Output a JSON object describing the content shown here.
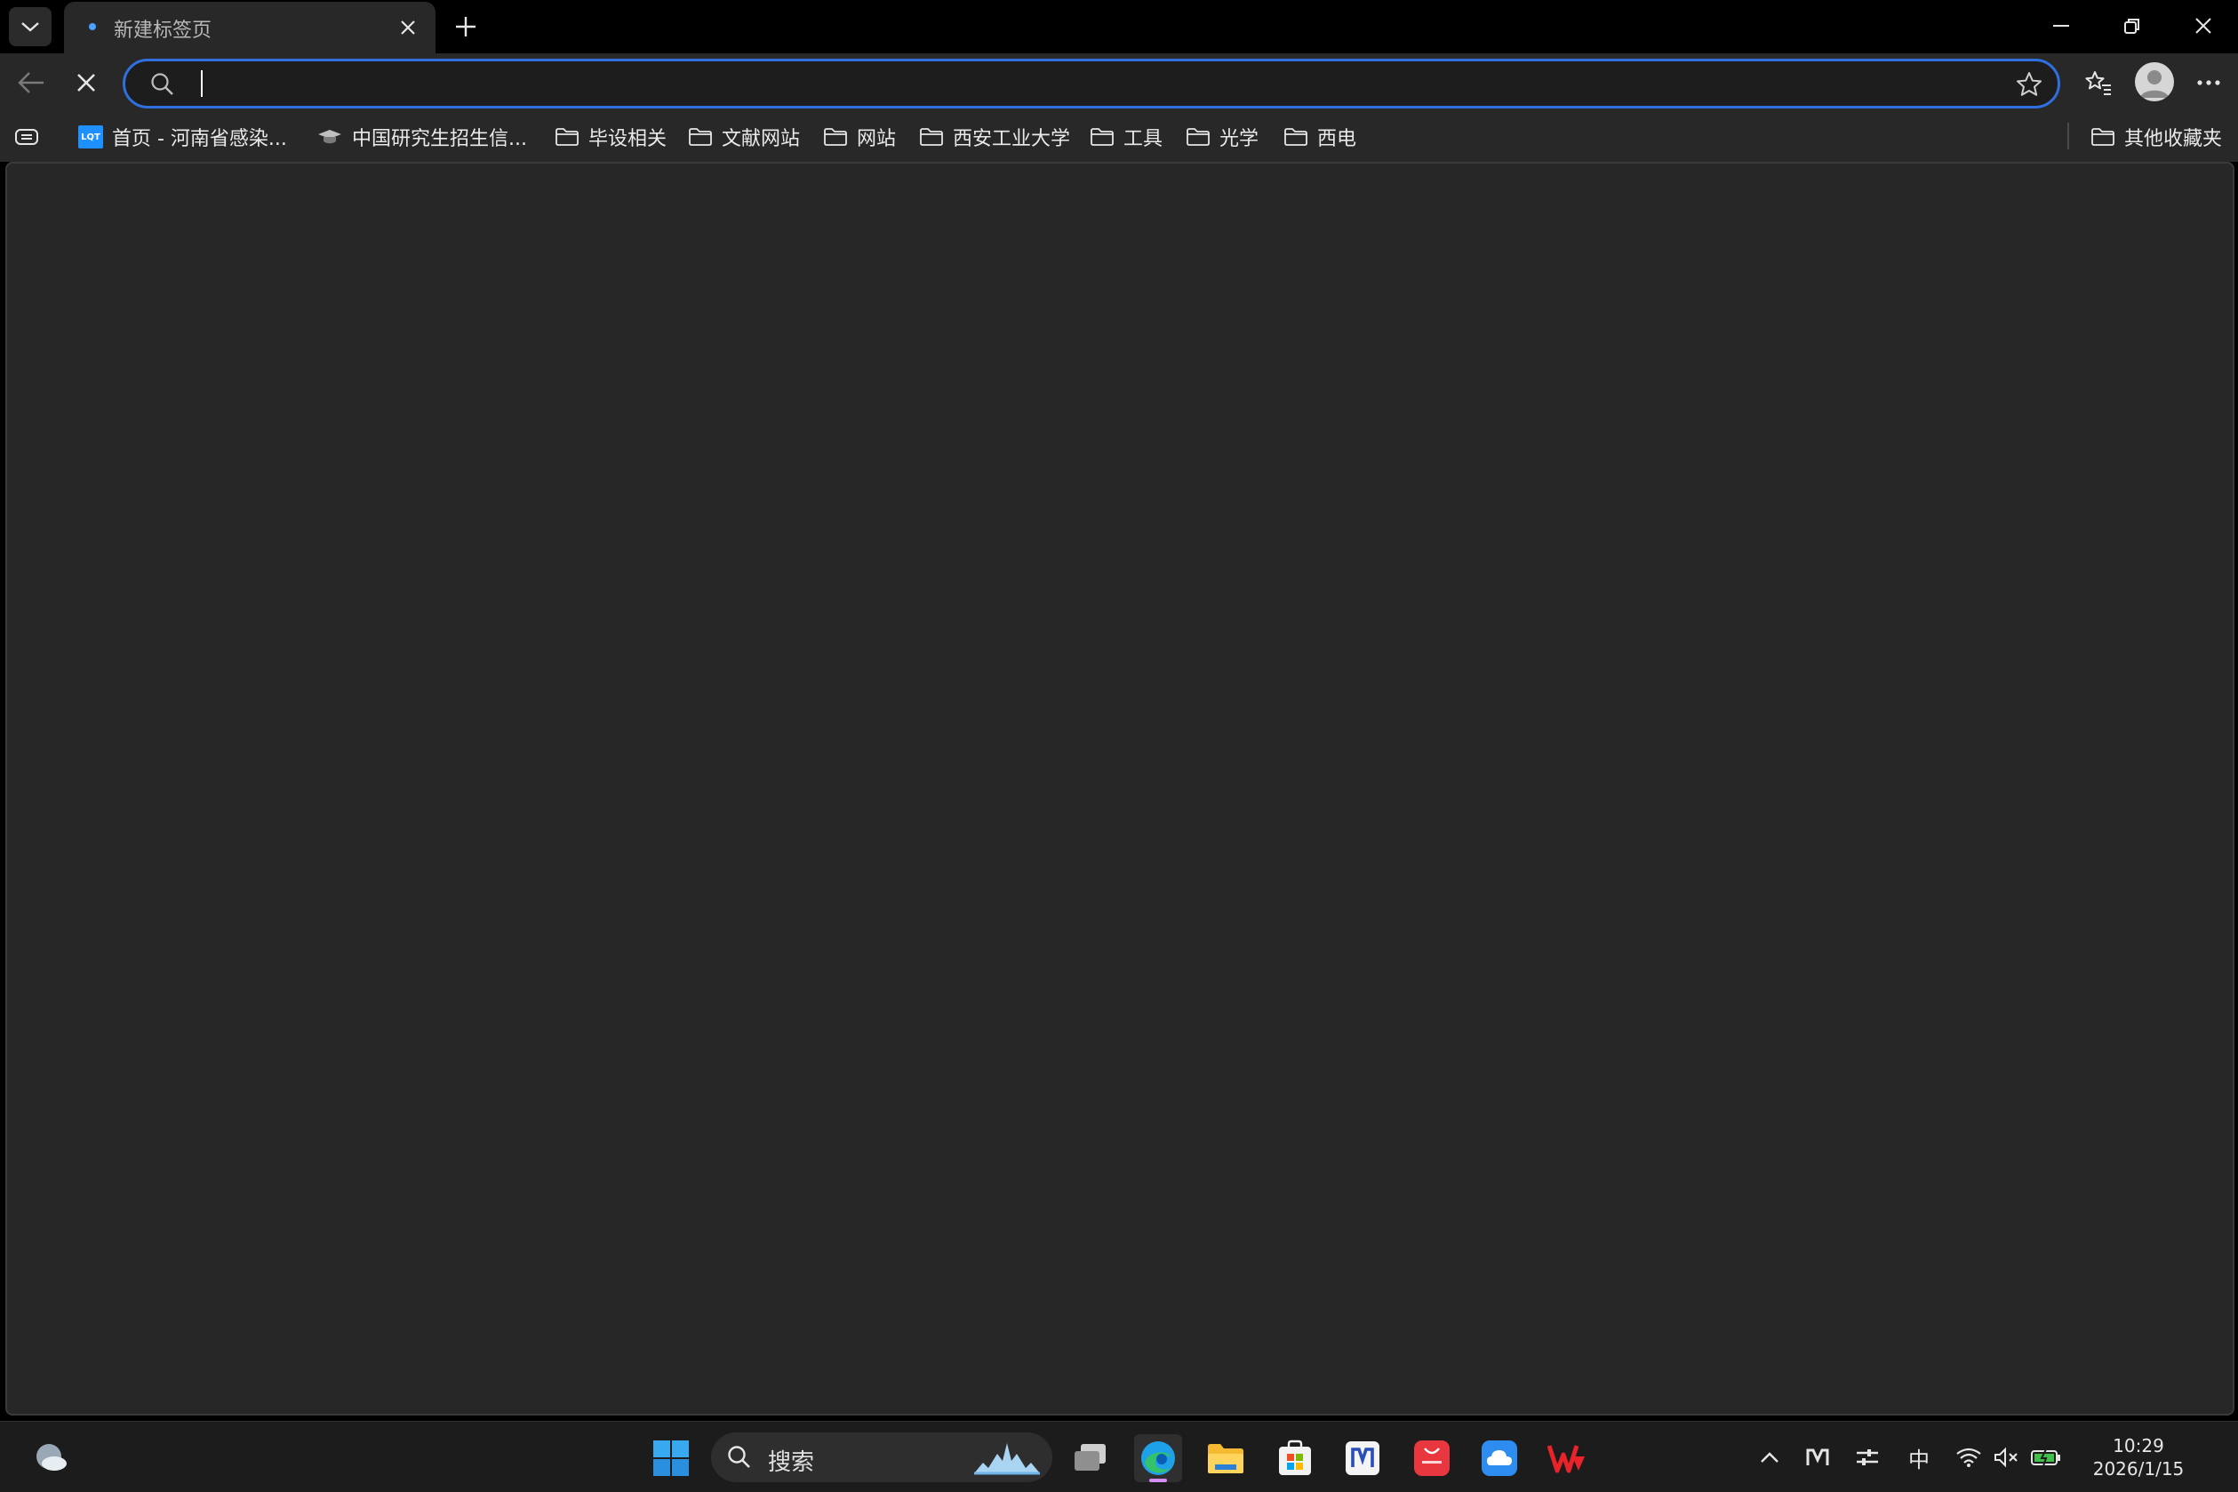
{
  "tab": {
    "title": "新建标签页"
  },
  "toolbar": {
    "address_value": "",
    "address_placeholder": ""
  },
  "bookmarks": {
    "items": [
      {
        "label": "首页 - 河南省感染...",
        "icon": "lqt-favicon",
        "icon_text": "LQT"
      },
      {
        "label": "中国研究生招生信...",
        "icon": "graduation-cap-icon"
      },
      {
        "label": "毕设相关",
        "icon": "folder-icon"
      },
      {
        "label": "文献网站",
        "icon": "folder-icon"
      },
      {
        "label": "网站",
        "icon": "folder-icon"
      },
      {
        "label": "西安工业大学",
        "icon": "folder-icon"
      },
      {
        "label": "工具",
        "icon": "folder-icon"
      },
      {
        "label": "光学",
        "icon": "folder-icon"
      },
      {
        "label": "西电",
        "icon": "folder-icon"
      }
    ],
    "other": "其他收藏夹"
  },
  "taskbar": {
    "search_label": "搜索",
    "ime": "中",
    "time": "10:29",
    "date": "2026/1/15"
  },
  "colors": {
    "accent": "#2f6fe0",
    "content_bg": "#272727",
    "toolbar_bg": "#282828"
  }
}
